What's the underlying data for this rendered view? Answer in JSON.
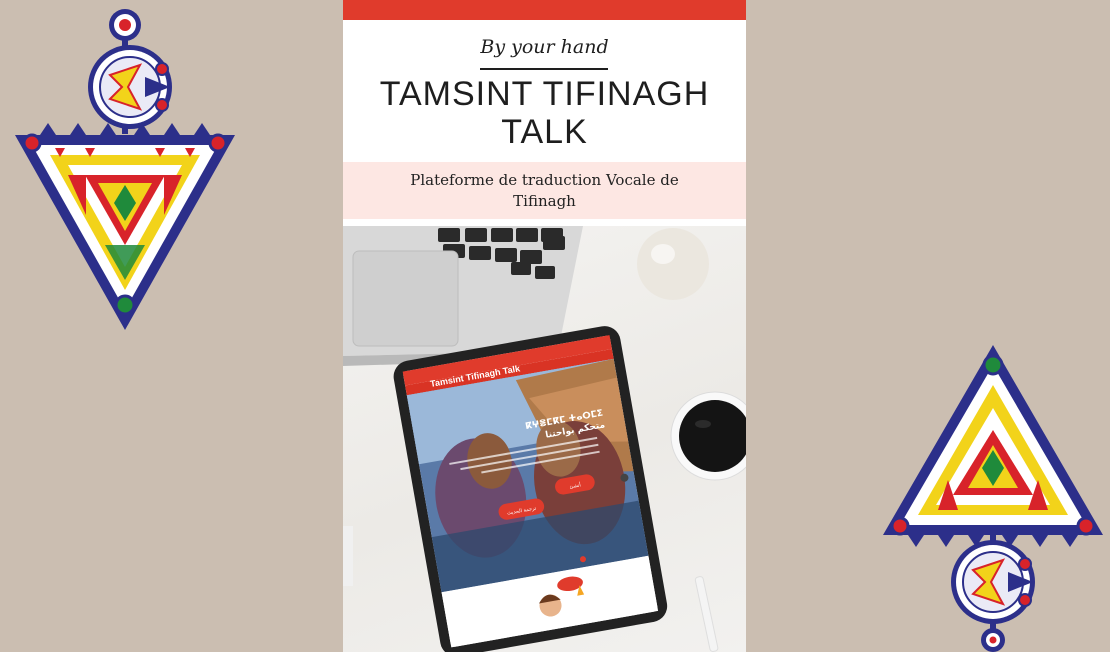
{
  "poster": {
    "tagline": "By your hand",
    "title_line1": "TAMSINT TIFINAGH",
    "title_line2": "TALK",
    "subtitle_line1": "Plateforme de traduction Vocale de",
    "subtitle_line2": "Tifinagh"
  },
  "tablet_screen": {
    "app_title": "Tamsint Tifinagh Talk",
    "hero_heading": "ⴽⵖⴻⵎⴽⵎ ⵜⴰⵔⵎⵉ",
    "hero_subtitle": "متحكم بواحتنا",
    "button_primary": "أنشئ",
    "button_secondary": "ترجمة الحديث"
  },
  "colors": {
    "background": "#cbbeb1",
    "accent_red": "#e03b2c",
    "pink_band": "#fde7e3",
    "ornament_navy": "#2c2f8a",
    "ornament_yellow": "#f2d31a",
    "ornament_red": "#d8232a",
    "ornament_green": "#1f8a3b"
  },
  "icons": [
    "amazigh-ornament-left",
    "amazigh-ornament-right"
  ]
}
